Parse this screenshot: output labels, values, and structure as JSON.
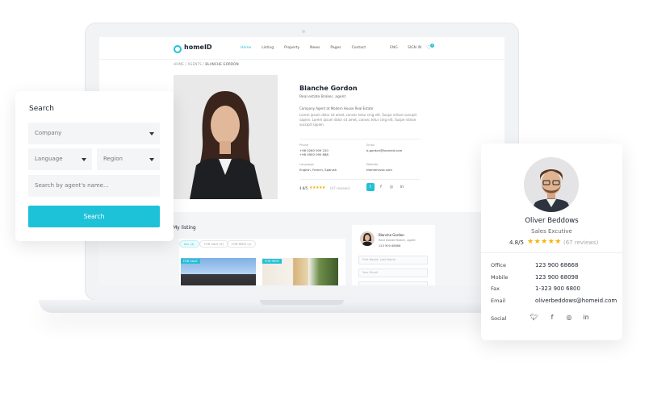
{
  "site": {
    "logo": "homeID",
    "nav": [
      "Home",
      "Listing",
      "Property",
      "News",
      "Pages",
      "Contact"
    ],
    "lang": "ENG",
    "login": "SIGN IN",
    "cart_count": "2"
  },
  "breadcrumb": [
    "HOME",
    "AGENTS",
    "BLANCHE GORDON"
  ],
  "agent": {
    "name": "Blanche Gordon",
    "role": "Real estate Broker, agent",
    "company": "Company Agent at Modern House Real Estate",
    "bio": "Lorem ipsum dolor sit amet, consec tetur cing elit. Suspe ndisse suscipit sapien. Lorem ipsum dolor sit amet, consec tetur cing elit. Suspe ndisse suscipit sapien.",
    "phone_label": "Phone",
    "phones": [
      "+98 0260 909 220",
      "+98 0900 090 888"
    ],
    "email_label": "Email",
    "email": "b.gordon@homeid.com",
    "language_label": "Language",
    "languages": "English, French, Spanish",
    "website_label": "Website",
    "website": "thememuse.com",
    "rating": "4.8/5",
    "reviews": "(67 reviews)"
  },
  "listing": {
    "title": "My listing",
    "tabs": [
      "ALL (3)",
      "FOR SALE (9)",
      "FOR RENT (2)"
    ],
    "badges": [
      "FOR SALE",
      "FOR RENT"
    ]
  },
  "contact_card": {
    "name": "Blanche Gordon",
    "role": "Real estate Broker, agent",
    "phone": "123 900 68668",
    "placeholders": [
      "First Name, Last Name",
      "Your Email"
    ]
  },
  "search": {
    "title": "Search",
    "company": "Company",
    "language": "Language",
    "region": "Region",
    "placeholder": "Search by agent's name...",
    "button": "Search"
  },
  "agent_card": {
    "name": "Oliver Beddows",
    "role": "Sales Excutive",
    "rating": "4.8/5",
    "stars": "★★★★★",
    "reviews": "(67 reviews)",
    "rows": [
      {
        "label": "Office",
        "value": "123 900 68668"
      },
      {
        "label": "Mobile",
        "value": "123 900 68098"
      },
      {
        "label": "Fax",
        "value": "1-323 900 6800"
      },
      {
        "label": "Email",
        "value": "oliverbeddows@homeid.com"
      }
    ],
    "social_label": "Social"
  },
  "colors": {
    "accent": "#1ec2d8",
    "star": "#f5b301"
  }
}
